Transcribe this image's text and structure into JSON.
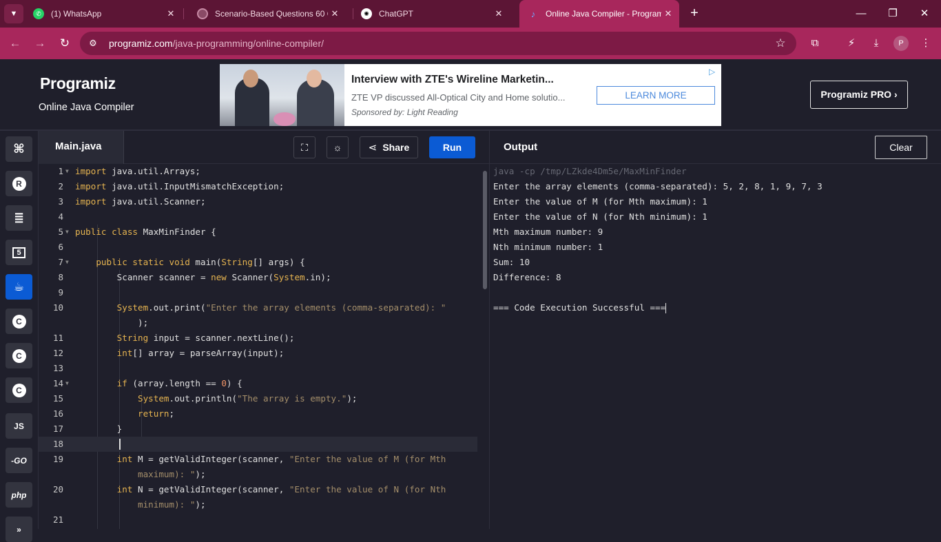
{
  "browser": {
    "tabs": [
      {
        "title": "(1) WhatsApp",
        "icon": "whatsapp-icon"
      },
      {
        "title": "Scenario-Based Questions 60 Q",
        "icon": "globe-icon"
      },
      {
        "title": "ChatGPT",
        "icon": "chatgpt-icon"
      },
      {
        "title": "Online Java Compiler - Program",
        "icon": "programiz-icon"
      }
    ],
    "url_domain": "programiz.com",
    "url_path": "/java-programming/online-compiler/",
    "profile_initial": "P"
  },
  "site": {
    "logo": "Programiz",
    "subtitle": "Online Java Compiler",
    "pro_button": "Programiz PRO ›",
    "ad": {
      "title": "Interview with ZTE's Wireline Marketin...",
      "description": "ZTE VP discussed All-Optical City and Home solutio...",
      "sponsor": "Sponsored by: Light Reading",
      "cta": "LEARN MORE"
    }
  },
  "languages": [
    {
      "name": "python-icon",
      "label": "Py"
    },
    {
      "name": "r-icon",
      "label": "R"
    },
    {
      "name": "sql-icon",
      "label": "DB"
    },
    {
      "name": "html-icon",
      "label": "5"
    },
    {
      "name": "java-icon",
      "label": "☕",
      "active": true
    },
    {
      "name": "c-icon",
      "label": "C"
    },
    {
      "name": "cpp-icon",
      "label": "C+"
    },
    {
      "name": "csharp-icon",
      "label": "C#"
    },
    {
      "name": "javascript-icon",
      "label": "JS"
    },
    {
      "name": "go-icon",
      "label": "-GO"
    },
    {
      "name": "php-icon",
      "label": "php"
    },
    {
      "name": "swift-icon",
      "label": "»"
    }
  ],
  "editor": {
    "file_name": "Main.java",
    "share_label": "Share",
    "run_label": "Run",
    "line_numbers": [
      "1",
      "2",
      "3",
      "4",
      "5",
      "6",
      "7",
      "8",
      "9",
      "10",
      "11",
      "12",
      "13",
      "14",
      "15",
      "16",
      "17",
      "18",
      "19",
      "20",
      "21"
    ]
  },
  "output": {
    "title": "Output",
    "clear_label": "Clear",
    "lines": [
      "java -cp /tmp/LZkde4Dm5e/MaxMinFinder",
      "Enter the array elements (comma-separated): 5, 2, 8, 1, 9, 7, 3",
      "Enter the value of M (for Mth maximum): 1",
      "Enter the value of N (for Nth minimum): 1",
      "Mth maximum number: 9",
      "Nth minimum number: 1",
      "Sum: 10",
      "Difference: 8",
      "",
      "=== Code Execution Successful ==="
    ]
  },
  "colors": {
    "tabbar": "#5c1535",
    "addressbar": "#a8275c",
    "page_bg": "#1f1f2b",
    "run_button": "#0b5bd4",
    "keyword": "#e6b450",
    "string": "#a48e6a"
  }
}
